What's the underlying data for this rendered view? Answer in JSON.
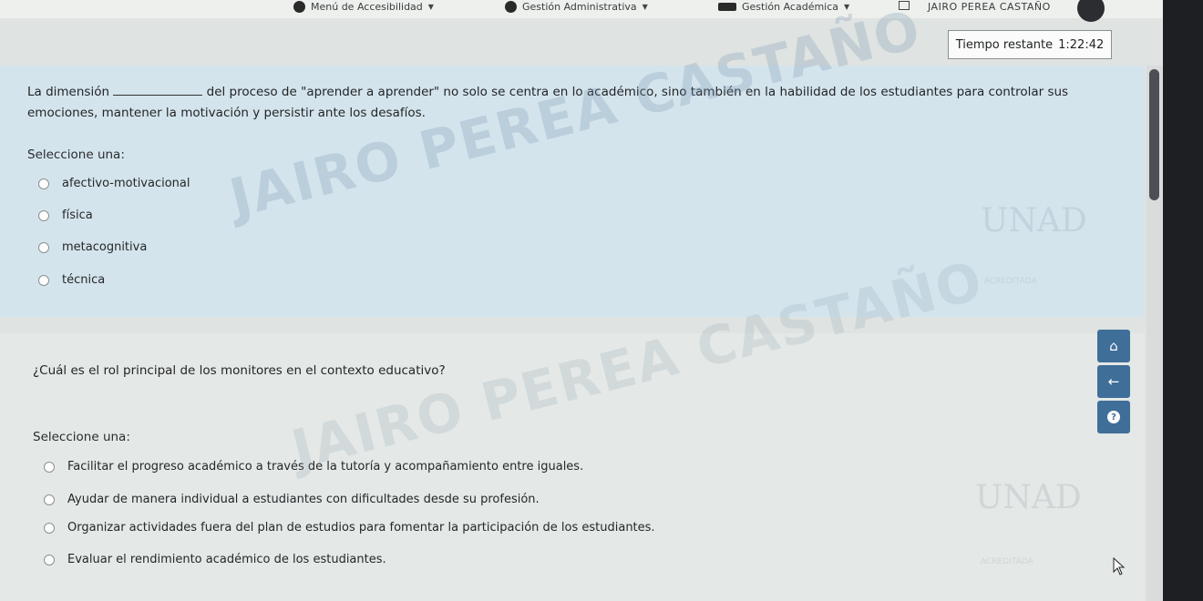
{
  "topbar": {
    "accessibility_menu": "Menú de Accesibilidad",
    "admin_menu": "Gestión Administrativa",
    "academic_menu": "Gestión Académica",
    "user_name": "JAIRO PEREA CASTAÑO"
  },
  "timer": {
    "label": "Tiempo restante",
    "value": "1:22:42"
  },
  "question1": {
    "text_before": "La dimensión",
    "text_after": "del proceso de \"aprender a aprender\" no solo se centra en lo académico, sino también en la habilidad de los estudiantes para controlar sus",
    "text_line2": "emociones, mantener la motivación y persistir ante los desafíos.",
    "select_label": "Seleccione una:",
    "options": [
      "afectivo-motivacional",
      "física",
      "metacognitiva",
      "técnica"
    ]
  },
  "question2": {
    "text": "¿Cuál es el rol principal de los monitores en el contexto educativo?",
    "select_label": "Seleccione una:",
    "options": [
      "Facilitar el progreso académico a través de la tutoría y acompañamiento entre iguales.",
      "Ayudar de manera individual a estudiantes con dificultades desde su profesión.",
      "Organizar actividades fuera del plan de estudios para fomentar la participación de los estudiantes.",
      "Evaluar el rendimiento académico de los estudiantes."
    ]
  },
  "watermark": {
    "text": "JAIRO PEREA CASTAÑO",
    "logo": "UNAD",
    "logo_sub": "ACREDITADA"
  },
  "icons": {
    "home": "home-icon",
    "back": "arrow-left-icon",
    "help": "help-icon"
  },
  "colors": {
    "question1_bg": "#d4e4ec",
    "question2_bg": "#e4e8e6",
    "float_button": "#3f6e99"
  }
}
